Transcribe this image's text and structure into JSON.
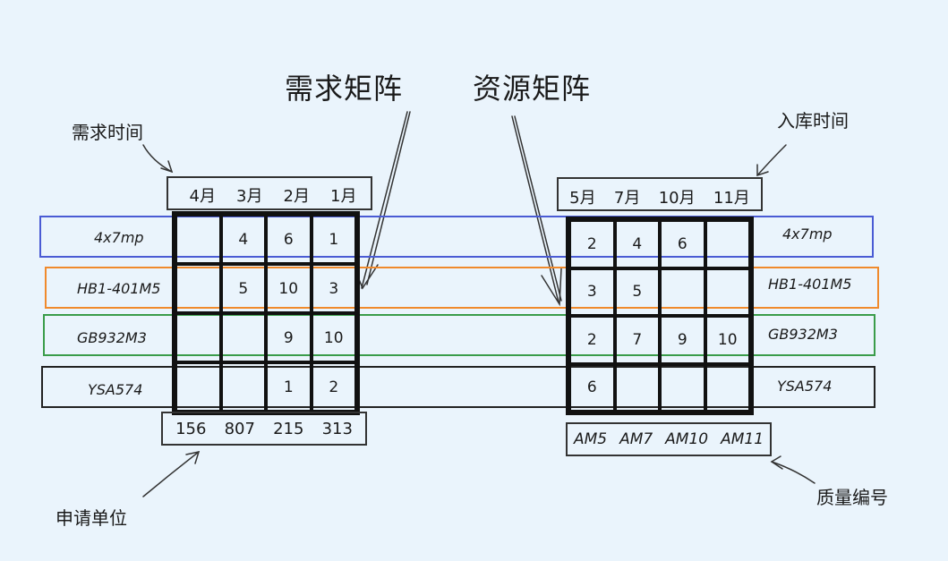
{
  "titles": {
    "demand_matrix": "需求矩阵",
    "resource_matrix": "资源矩阵"
  },
  "annotations": {
    "demand_time": "需求时间",
    "stock_in_time": "入库时间",
    "applicant_unit": "申请单位",
    "quality_code": "质量编号"
  },
  "colors": {
    "background": "#eaf4fc",
    "row_4x7mp": "#4a5bd4",
    "row_HB1": "#f08a2c",
    "row_GB932": "#3a9c4a",
    "row_YSA574": "#222222"
  },
  "demand": {
    "months": [
      "4月",
      "3月",
      "2月",
      "1月"
    ],
    "units": [
      "156",
      "807",
      "215",
      "313"
    ],
    "rows": [
      {
        "label": "4x7mp",
        "cells": [
          "",
          "4",
          "6",
          "1"
        ]
      },
      {
        "label": "HB1-401M5",
        "cells": [
          "",
          "5",
          "10",
          "3"
        ]
      },
      {
        "label": "GB932M3",
        "cells": [
          "",
          "",
          "9",
          "10"
        ]
      },
      {
        "label": "YSA574",
        "cells": [
          "",
          "",
          "1",
          "2"
        ]
      }
    ]
  },
  "resource": {
    "months": [
      "5月",
      "7月",
      "10月",
      "11月"
    ],
    "codes": [
      "AM5",
      "AM7",
      "AM10",
      "AM11"
    ],
    "rows": [
      {
        "label": "4x7mp",
        "cells": [
          "2",
          "4",
          "6",
          ""
        ]
      },
      {
        "label": "HB1-401M5",
        "cells": [
          "3",
          "5",
          "",
          ""
        ]
      },
      {
        "label": "GB932M3",
        "cells": [
          "2",
          "7",
          "9",
          "10"
        ]
      },
      {
        "label": "YSA574",
        "cells": [
          "6",
          "",
          "",
          ""
        ]
      }
    ]
  }
}
